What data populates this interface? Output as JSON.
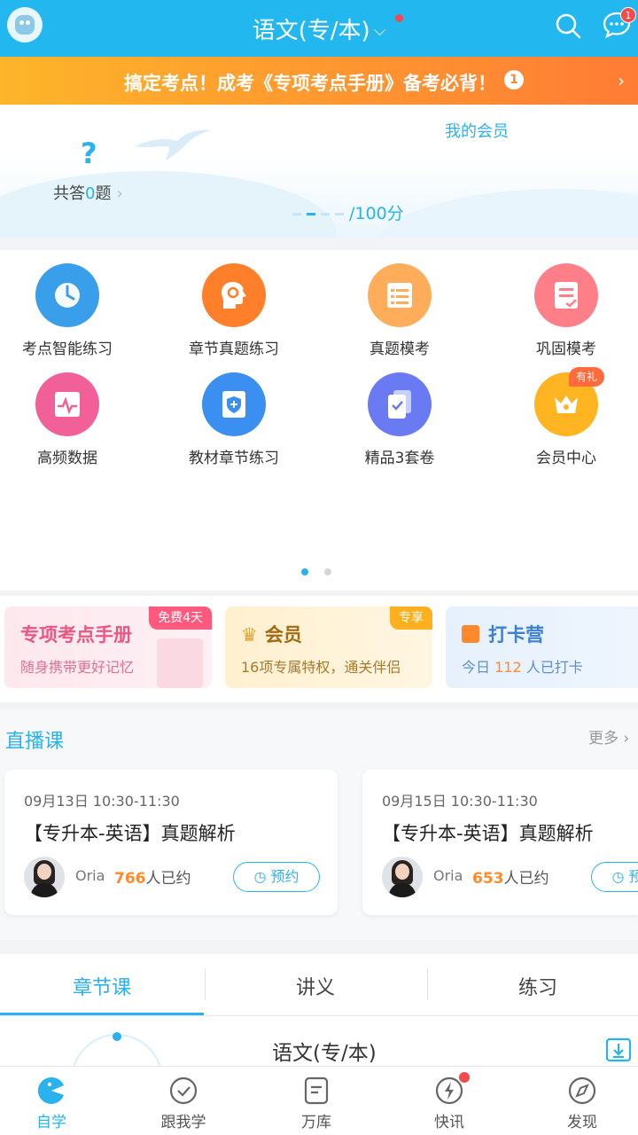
{
  "header": {
    "title": "语文(专/本)",
    "chevron": "⌵",
    "message_badge": "1"
  },
  "promo": {
    "text": "搞定考点！成考《专项考点手册》备考必背！",
    "badge": "1",
    "arrow": "›"
  },
  "hero": {
    "answered_prefix": "共答",
    "answered_count": "0",
    "answered_suffix": "题",
    "arrow": "›",
    "member_link": "我的会员",
    "score_suffix": "/100分"
  },
  "grid": {
    "items": [
      {
        "label": "考点智能练习",
        "icon": "clock-icon",
        "color": "#3a9fea"
      },
      {
        "label": "章节真题练习",
        "icon": "head-gear-icon",
        "color": "#ff7f2a"
      },
      {
        "label": "真题模考",
        "icon": "paper-list-icon",
        "color": "#ffad5a"
      },
      {
        "label": "巩固模考",
        "icon": "doc-edit-icon",
        "color": "#ff7f88"
      },
      {
        "label": "高频数据",
        "icon": "pulse-chart-icon",
        "color": "#f2609a"
      },
      {
        "label": "教材章节练习",
        "icon": "shield-book-icon",
        "color": "#3a8ff0"
      },
      {
        "label": "精品3套卷",
        "icon": "stack-check-icon",
        "color": "#6a7af2"
      },
      {
        "label": "会员中心",
        "icon": "crown-icon",
        "color": "#ffb521"
      }
    ],
    "gift_badge": "有礼"
  },
  "cards": [
    {
      "title": "专项考点手册",
      "subtitle": "随身携带更好记忆",
      "tag": "免费4天"
    },
    {
      "title": "会员",
      "subtitle": "16项专属特权，通关伴侣",
      "tag": "专享"
    },
    {
      "title": "打卡营",
      "subtitle_prefix": "今日",
      "subtitle_count": "112",
      "subtitle_suffix": "人已打卡"
    }
  ],
  "live": {
    "title": "直播课",
    "more": "更多 ›",
    "courses": [
      {
        "time": "09月13日 10:30-11:30",
        "title": "【专升本-英语】真题解析",
        "teacher": "Oria",
        "count": "766",
        "count_suffix": "人已约",
        "button": "预约"
      },
      {
        "time": "09月15日 10:30-11:30",
        "title": "【专升本-英语】真题解析",
        "teacher": "Oria",
        "count": "653",
        "count_suffix": "人已约",
        "button": "预约"
      }
    ]
  },
  "tabs": [
    {
      "label": "章节课"
    },
    {
      "label": "讲义"
    },
    {
      "label": "练习"
    }
  ],
  "course": {
    "title": "语文(专/本)"
  },
  "bottom_nav": [
    {
      "label": "自学",
      "icon": "pacman-icon"
    },
    {
      "label": "跟我学",
      "icon": "check-circle-icon"
    },
    {
      "label": "万库",
      "icon": "document-icon"
    },
    {
      "label": "快讯",
      "icon": "lightning-icon"
    },
    {
      "label": "发现",
      "icon": "compass-icon"
    }
  ],
  "colors": {
    "accent": "#2ab2ee",
    "header": "#23b7ef",
    "orange": "#ff8a2b",
    "badge": "#f24b4b"
  }
}
